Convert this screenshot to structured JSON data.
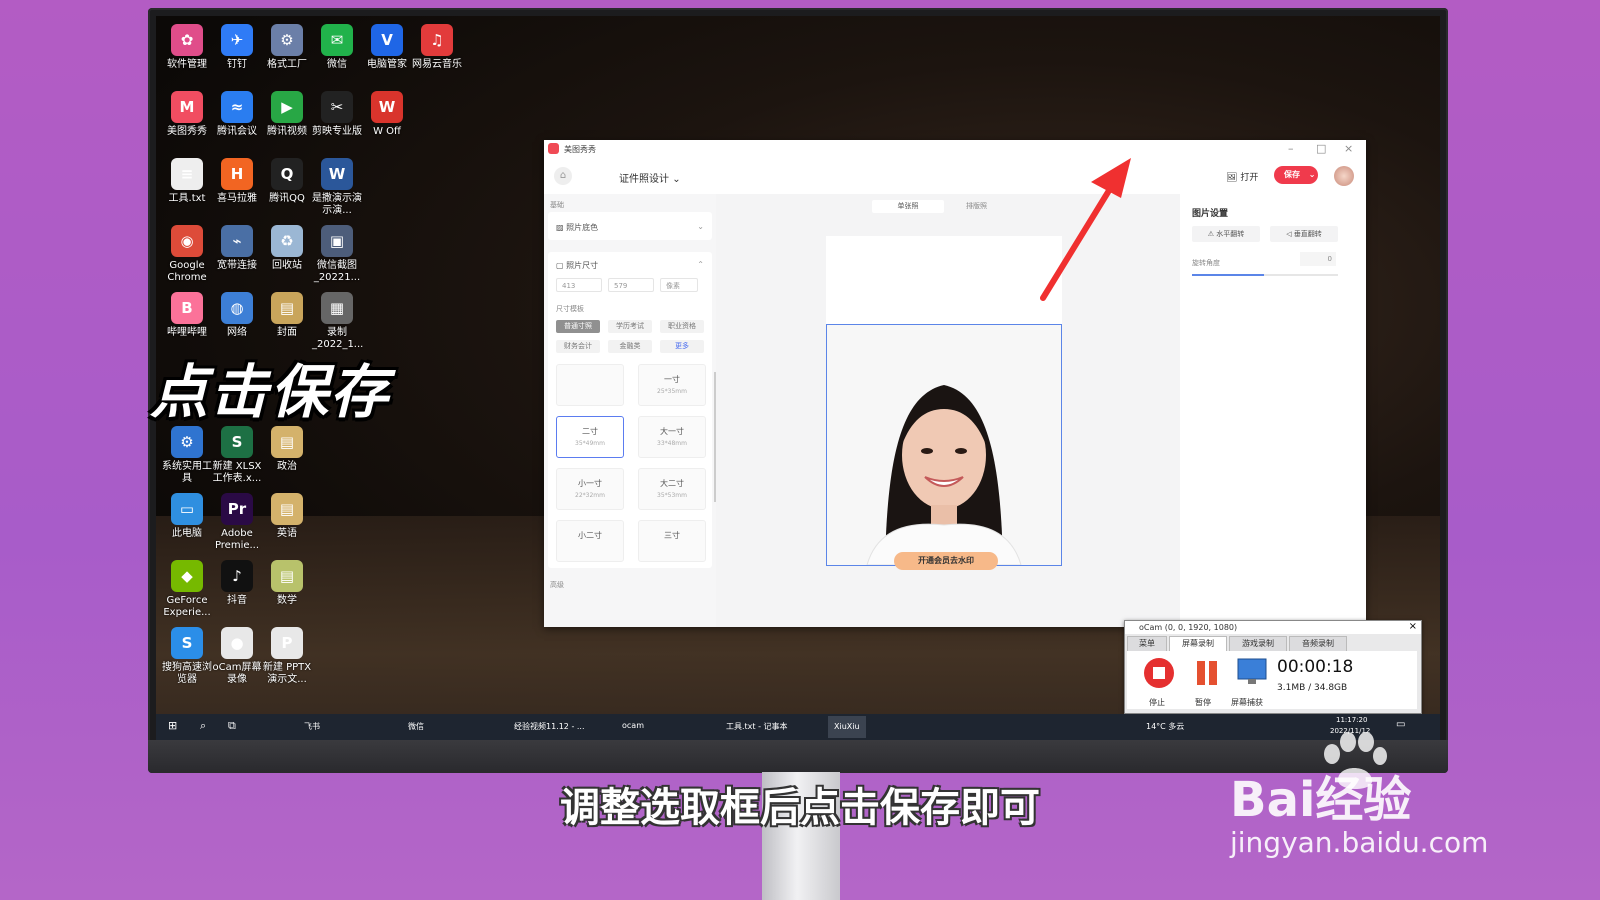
{
  "desktop": {
    "icons": [
      {
        "label": "软件管理",
        "color": "#e04d8a",
        "glyph": "✿"
      },
      {
        "label": "钉钉",
        "color": "#2f7bf6",
        "glyph": "✈"
      },
      {
        "label": "格式工厂",
        "color": "#6b7fa8",
        "glyph": "⚙"
      },
      {
        "label": "微信",
        "color": "#21b24b",
        "glyph": "✉"
      },
      {
        "label": "电脑管家",
        "color": "#1f66e6",
        "glyph": "V"
      },
      {
        "label": "网易云音乐",
        "color": "#e23b3b",
        "glyph": "♫"
      },
      {
        "label": "美图秀秀",
        "color": "#f14d61",
        "glyph": "M"
      },
      {
        "label": "腾讯会议",
        "color": "#2a7df0",
        "glyph": "≈"
      },
      {
        "label": "腾讯视频",
        "color": "#28a745",
        "glyph": "▶"
      },
      {
        "label": "剪映专业版",
        "color": "#222222",
        "glyph": "✂"
      },
      {
        "label": "W Off",
        "color": "#d9342c",
        "glyph": "W"
      },
      {
        "label": "工具.txt",
        "color": "#eeeeee",
        "glyph": "≡"
      },
      {
        "label": "喜马拉雅",
        "color": "#f26522",
        "glyph": "H"
      },
      {
        "label": "腾讯QQ",
        "color": "#222222",
        "glyph": "Q"
      },
      {
        "label": "是撒演示演示演...",
        "color": "#2b579a",
        "glyph": "W"
      },
      {
        "label": "Google Chrome",
        "color": "#dd4b39",
        "glyph": "◉"
      },
      {
        "label": "宽带连接",
        "color": "#4a6fa5",
        "glyph": "⌁"
      },
      {
        "label": "回收站",
        "color": "#9bb7d4",
        "glyph": "♻"
      },
      {
        "label": "微信截图_20221...",
        "color": "#4d5d7a",
        "glyph": "▣"
      },
      {
        "label": "哔哩哔哩",
        "color": "#fb7299",
        "glyph": "B"
      },
      {
        "label": "网络",
        "color": "#3d7fd6",
        "glyph": "◍"
      },
      {
        "label": "封面",
        "color": "#c9a55b",
        "glyph": "▤"
      },
      {
        "label": "录制_2022_1...",
        "color": "#666666",
        "glyph": "▦"
      },
      {
        "label": "系统实用工具",
        "color": "#2f74d0",
        "glyph": "⚙"
      },
      {
        "label": "新建 XLSX 工作表.x...",
        "color": "#1d7044",
        "glyph": "S"
      },
      {
        "label": "政治",
        "color": "#d4b26b",
        "glyph": "▤"
      },
      {
        "label": "此电脑",
        "color": "#2f8fe0",
        "glyph": "▭"
      },
      {
        "label": "Adobe Premie...",
        "color": "#2a0a45",
        "glyph": "Pr"
      },
      {
        "label": "英语",
        "color": "#d4b26b",
        "glyph": "▤"
      },
      {
        "label": "GeForce Experie...",
        "color": "#76b900",
        "glyph": "◆"
      },
      {
        "label": "抖音",
        "color": "#111111",
        "glyph": "♪"
      },
      {
        "label": "数学",
        "color": "#b8c26b",
        "glyph": "▤"
      },
      {
        "label": "搜狗高速浏览器",
        "color": "#2b8ee8",
        "glyph": "S"
      },
      {
        "label": "oCam屏幕录像",
        "color": "#e8e8e8",
        "glyph": "●"
      },
      {
        "label": "新建 PPTX 演示文...",
        "color": "#e8e8e8",
        "glyph": "P"
      }
    ]
  },
  "overlay": {
    "big_caption": "点击保存",
    "subtitle": "调整选取框后点击保存即可",
    "watermark_brand": "Bai经验",
    "watermark_url": "jingyan.baidu.com"
  },
  "app": {
    "window_title": "美图秀秀",
    "tool_title": "证件照设计",
    "open_label": "打开",
    "save_label": "保存",
    "sidebar": {
      "section_basic": "基础",
      "bg_color": "照片底色",
      "photo_size": "照片尺寸",
      "width_value": "413",
      "height_value": "579",
      "unit": "像素",
      "size_template": "尺寸模板",
      "chips": [
        "普通寸照",
        "学历考试",
        "职业资格",
        "财务会计",
        "金融类",
        "更多"
      ],
      "cards": [
        {
          "title": "",
          "size": ""
        },
        {
          "title": "一寸",
          "size": "25*35mm"
        },
        {
          "title": "二寸",
          "size": "35*49mm"
        },
        {
          "title": "大一寸",
          "size": "33*48mm"
        },
        {
          "title": "小一寸",
          "size": "22*32mm"
        },
        {
          "title": "大二寸",
          "size": "35*53mm"
        },
        {
          "title": "小二寸",
          "size": ""
        },
        {
          "title": "三寸",
          "size": ""
        }
      ],
      "section_advanced": "高级"
    },
    "canvas": {
      "tab_single": "单张照",
      "tab_layout": "排版照",
      "member_button": "开通会员去水印"
    },
    "right_panel": {
      "title": "图片设置",
      "flip_h": "水平翻转",
      "flip_v": "垂直翻转",
      "rotate_label": "旋转角度",
      "rotate_value": "0"
    }
  },
  "ocam": {
    "title": "oCam (0, 0, 1920, 1080)",
    "tabs": [
      "菜单",
      "屏幕录制",
      "游戏录制",
      "音频录制"
    ],
    "stop": "停止",
    "pause": "暂停",
    "capture": "屏幕捕获",
    "time": "00:00:18",
    "size": "3.1MB / 34.8GB"
  },
  "taskbar": {
    "items": [
      "飞书",
      "微信",
      "经验视频11.12 - ...",
      "ocam",
      "工具.txt - 记事本",
      "XiuXiu"
    ],
    "weather": "14°C 多云",
    "clock": "11:17:20",
    "date": "2022/11/12"
  }
}
